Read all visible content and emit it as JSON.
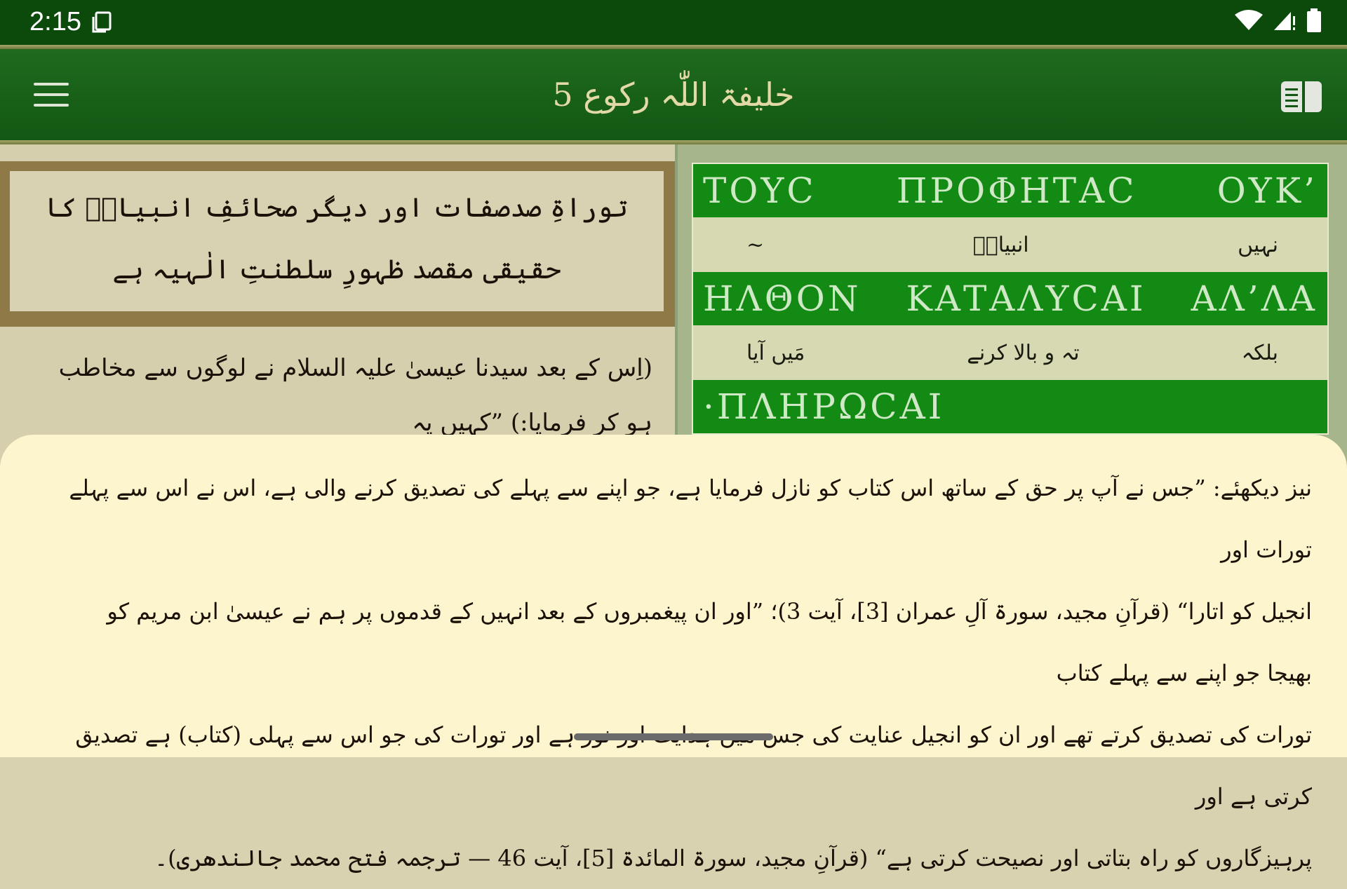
{
  "status_bar": {
    "time": "2:15",
    "icons": [
      "screen-icon",
      "wifi-icon",
      "signal-icon",
      "battery-icon"
    ]
  },
  "app_bar": {
    "title": "خلیفۃ اللّٰہ رکوع 5",
    "icons": [
      "menu-icon",
      "book-icon"
    ]
  },
  "left_panel": {
    "heading": "توراۃِ صدصفات اور دیگر صحائفِ انبیاءؑ کا حقیقی مقصد ظہورِ سلطنتِ الٰہیہ ہے",
    "body_line_1": "(اِس کے بعد سیدنا عیسیٰ علیہ السلام نے لوگوں سے مخاطب ہو کر فرمایا:) ”کہیں یہ"
  },
  "interlinear": {
    "rows": [
      {
        "greek": [
          "ΟΥΚ’",
          "ΠΡΟΦΗΤΑϹ",
          "ΤΟΥϹ"
        ],
        "urdu": [
          "نہیں",
          "انبیاءؑ",
          "~"
        ]
      },
      {
        "greek": [
          "ΑΛ’ΛΑ",
          "ΚΑΤΑΛΥϹΑΙ",
          "ΗΛΘΟΝ"
        ],
        "urdu": [
          "بلکہ",
          "تہ و بالا کرنے",
          "مَیں آیا"
        ]
      },
      {
        "greek": [
          "·ΠΛΗΡΩϹΑΙ"
        ]
      }
    ]
  },
  "bottom_sheet": {
    "line_1": "نیز دیکھئے: ”جس نے آپ پر حق کے ساتھ اس کتاب کو نازل فرمایا ہے، جو اپنے سے پہلے کی تصدیق کرنے والی ہے، اس نے اس سے پہلے تورات اور",
    "line_2": "انجیل کو اتارا“ (قرآنِ مجید، سورۃ آلِ عمران [3]، آیت 3)؛ ”اور ان پیغمبروں کے بعد انہیں کے قدموں پر ہم نے عیسیٰ ابن مریم کو بھیجا جو اپنے سے پہلے کتاب",
    "line_3": "تورات کی تصدیق کرتے تھے اور ان کو انجیل عنایت کی جس میں ہدایت اور نور ہے اور تورات کی جو اس سے پہلی (کتاب) ہے تصدیق کرتی ہے اور",
    "line_4": "پرہیزگاروں کو راہ بتاتی اور نصیحت کرتی ہے“ (قرآنِ مجید، سورۃ المائدۃ [5]، آیت 46 — ترجمہ فتح محمد جالندھری)۔"
  }
}
